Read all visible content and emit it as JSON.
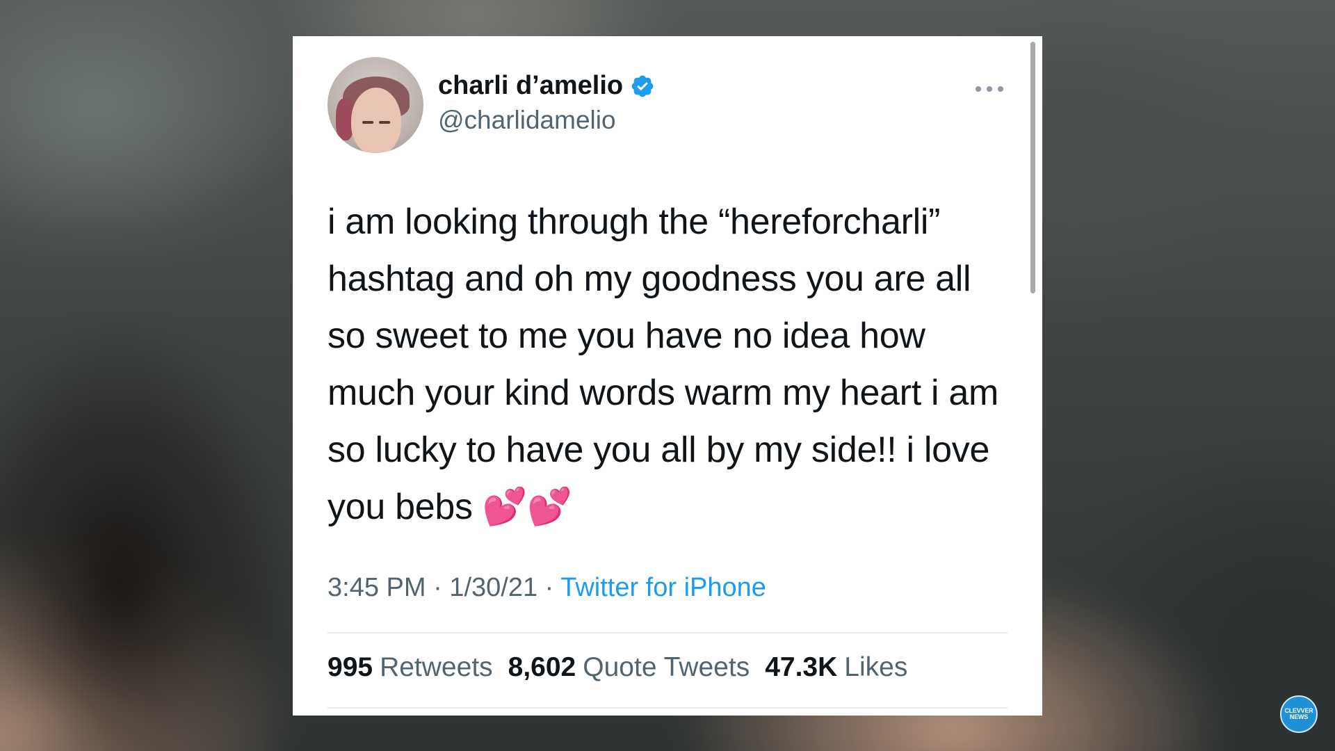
{
  "tweet": {
    "author_name": "charli d’amelio",
    "handle": "@charlidamelio",
    "verified": true,
    "text": "i am looking through the “hereforcharli” hashtag and oh my goodness you are all so sweet to me you have no idea how much your kind words warm my heart i am so lucky to have you all by my side!! i love you bebs 💕💕",
    "time": "3:45 PM",
    "date": "1/30/21",
    "separator": "·",
    "source": "Twitter for iPhone"
  },
  "stats": {
    "retweets_count": "995",
    "retweets_label": "Retweets",
    "quotes_count": "8,602",
    "quotes_label": "Quote Tweets",
    "likes_count": "47.3K",
    "likes_label": "Likes"
  },
  "overlay": {
    "logo_line1": "CLEVVER",
    "logo_line2": "NEWS"
  },
  "colors": {
    "verified_badge": "#1d9bf0",
    "link": "#1d9bf0",
    "secondary_text": "#536471"
  }
}
